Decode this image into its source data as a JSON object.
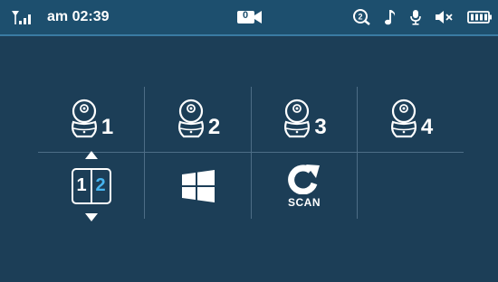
{
  "status_bar": {
    "signal_icon": "signal-antenna-icon",
    "time": "am 02:39",
    "camera_badge": "0",
    "right_icons": [
      "record-2-icon",
      "music-note-icon",
      "microphone-icon",
      "speaker-muted-icon",
      "battery-full-icon"
    ]
  },
  "cameras": [
    {
      "number": "1",
      "icon": "camera-icon"
    },
    {
      "number": "2",
      "icon": "camera-icon"
    },
    {
      "number": "3",
      "icon": "camera-icon"
    },
    {
      "number": "4",
      "icon": "camera-icon"
    }
  ],
  "split_view": {
    "left": "1",
    "right": "2"
  },
  "scan": {
    "label": "SCAN"
  },
  "colors": {
    "background": "#1c3e57",
    "status_bar": "#1d4f6e",
    "accent": "#46b5f0"
  }
}
